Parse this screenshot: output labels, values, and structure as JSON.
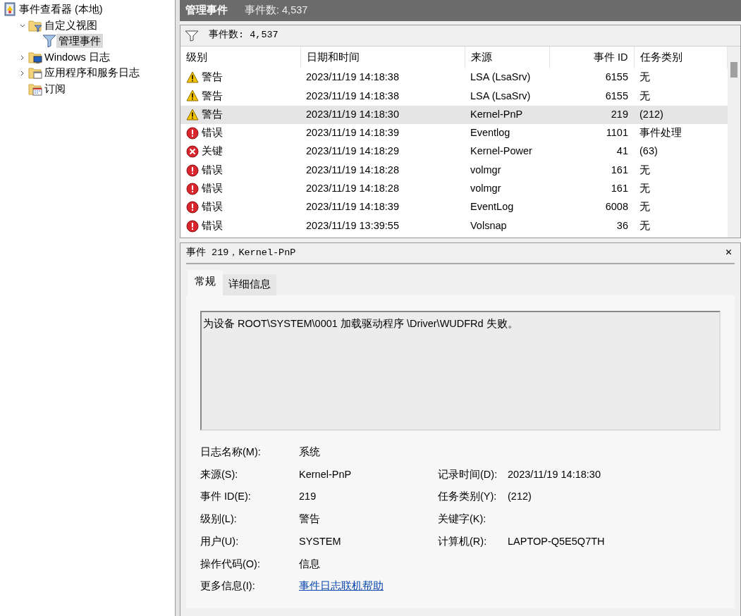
{
  "tree": [
    {
      "label": "事件查看器 (本地)",
      "kind": "viewer",
      "selected": false,
      "children": [
        {
          "label": "自定义视图",
          "kind": "folder-filter",
          "selected": false,
          "expanded": true,
          "children": [
            {
              "label": "管理事件",
              "kind": "filter",
              "selected": true
            }
          ]
        },
        {
          "label": "Windows 日志",
          "kind": "folder-monitor",
          "selected": false,
          "expanded": false
        },
        {
          "label": "应用程序和服务日志",
          "kind": "folder-window",
          "selected": false,
          "expanded": false
        },
        {
          "label": "订阅",
          "kind": "folder-calendar",
          "selected": false
        }
      ]
    }
  ],
  "header": {
    "title": "管理事件",
    "count": "事件数: 4,537"
  },
  "filter_bar": {
    "text": "事件数: 4,537"
  },
  "table": {
    "columns": [
      "级别",
      "日期和时间",
      "来源",
      "事件 ID",
      "任务类别"
    ],
    "rows": [
      {
        "kind": "warning",
        "level": "警告",
        "datetime": "2023/11/19 14:18:38",
        "source": "LSA (LsaSrv)",
        "id": "6155",
        "category": "无",
        "selected": false
      },
      {
        "kind": "warning",
        "level": "警告",
        "datetime": "2023/11/19 14:18:38",
        "source": "LSA (LsaSrv)",
        "id": "6155",
        "category": "无",
        "selected": false
      },
      {
        "kind": "warning",
        "level": "警告",
        "datetime": "2023/11/19 14:18:30",
        "source": "Kernel-PnP",
        "id": "219",
        "category": "(212)",
        "selected": true
      },
      {
        "kind": "error",
        "level": "错误",
        "datetime": "2023/11/19 14:18:39",
        "source": "Eventlog",
        "id": "1101",
        "category": "事件处理",
        "selected": false
      },
      {
        "kind": "critical",
        "level": "关键",
        "datetime": "2023/11/19 14:18:29",
        "source": "Kernel-Power",
        "id": "41",
        "category": "(63)",
        "selected": false
      },
      {
        "kind": "error",
        "level": "错误",
        "datetime": "2023/11/19 14:18:28",
        "source": "volmgr",
        "id": "161",
        "category": "无",
        "selected": false
      },
      {
        "kind": "error",
        "level": "错误",
        "datetime": "2023/11/19 14:18:28",
        "source": "volmgr",
        "id": "161",
        "category": "无",
        "selected": false
      },
      {
        "kind": "error",
        "level": "错误",
        "datetime": "2023/11/19 14:18:39",
        "source": "EventLog",
        "id": "6008",
        "category": "无",
        "selected": false
      },
      {
        "kind": "error",
        "level": "错误",
        "datetime": "2023/11/19 13:39:55",
        "source": "Volsnap",
        "id": "36",
        "category": "无",
        "selected": false
      }
    ]
  },
  "detail": {
    "title": "事件 219，Kernel-PnP",
    "close": "✕",
    "tabs": [
      {
        "label": "常规",
        "selected": true
      },
      {
        "label": "详细信息",
        "selected": false
      }
    ],
    "message": "为设备 ROOT\\SYSTEM\\0001 加载驱动程序 \\Driver\\WUDFRd 失败。",
    "fields": [
      {
        "label": "日志名称(M):",
        "value": "系统"
      },
      {
        "label": "来源(S):",
        "value": "Kernel-PnP",
        "label2": "记录时间(D):",
        "value2": "2023/11/19 14:18:30"
      },
      {
        "label": "事件 ID(E):",
        "value": "219",
        "label2": "任务类别(Y):",
        "value2": "(212)"
      },
      {
        "label": "级别(L):",
        "value": "警告",
        "label2": "关键字(K):"
      },
      {
        "label": "用户(U):",
        "value": "SYSTEM",
        "label2": "计算机(R):",
        "value2": "LAPTOP-Q5E5Q7TH"
      },
      {
        "label": "操作代码(O):",
        "value": "信息"
      },
      {
        "label": "更多信息(I):",
        "value": "事件日志联机帮助",
        "kind": "link"
      }
    ]
  }
}
